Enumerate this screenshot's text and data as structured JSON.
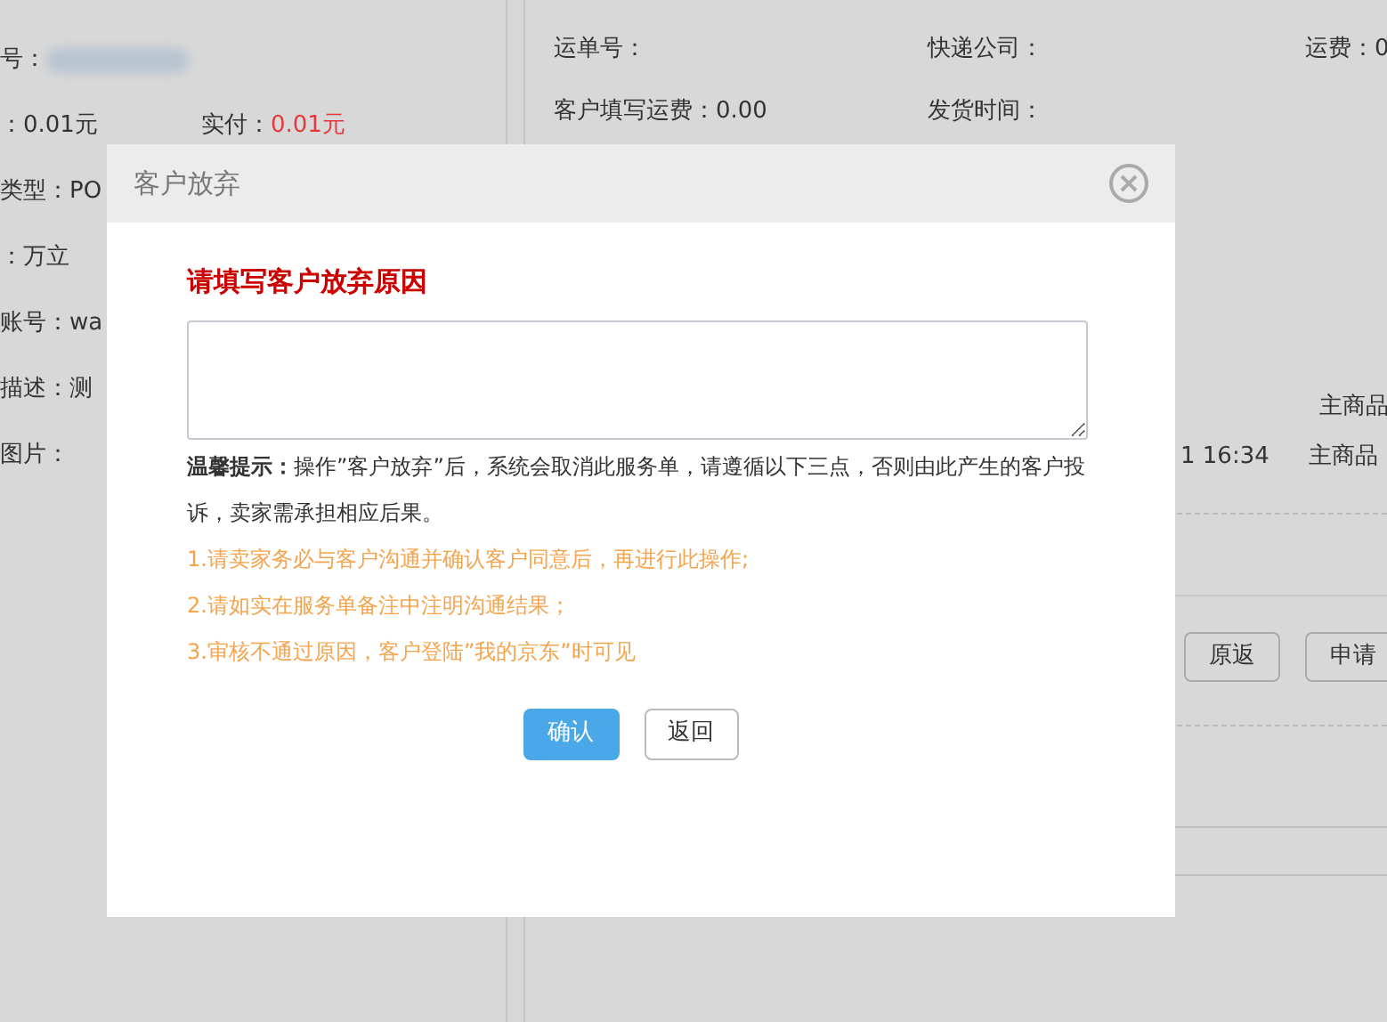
{
  "background": {
    "left_fields": [
      {
        "label": "号：",
        "blurred": true
      },
      {
        "label": "：",
        "value": "0.01元",
        "extra_label": "实付：",
        "extra_value": "0.01元"
      },
      {
        "label": "类型：",
        "value": "PO"
      },
      {
        "label": "：",
        "value": "万立"
      },
      {
        "label": "账号：",
        "value": "wa"
      },
      {
        "label": "描述：",
        "value": "测"
      },
      {
        "label": "图片："
      }
    ],
    "shipping": [
      {
        "label": "运单号："
      },
      {
        "label": "快递公司："
      },
      {
        "label": "运费：",
        "value": "0"
      },
      {
        "label": "客户填写运费：",
        "value": "0.00"
      },
      {
        "label": "发货时间："
      }
    ],
    "time_text": "1 16:34",
    "product_labels": [
      "主商品",
      "主商品"
    ],
    "buttons": [
      "原返",
      "申请"
    ]
  },
  "dialog": {
    "title": "客户放弃",
    "heading": "请填写客户放弃原因",
    "notice": "**温馨提示：**操作”客户放弃”后，系统会取消此服务单，请遵循以下三点，否则由此产生的客户投诉，卖家需承担相应后果。",
    "rules": [
      "1.请卖家务必与客户沟通并确认客户同意后，再进行此操作;",
      "2.请如实在服务单备注中注明沟通结果；",
      "3.审核不通过原因，客户登陆”我的京东”时可见"
    ],
    "buttons": [
      {
        "label": "确认",
        "kind": "primary"
      },
      {
        "label": "返回",
        "kind": "secondary"
      }
    ]
  }
}
